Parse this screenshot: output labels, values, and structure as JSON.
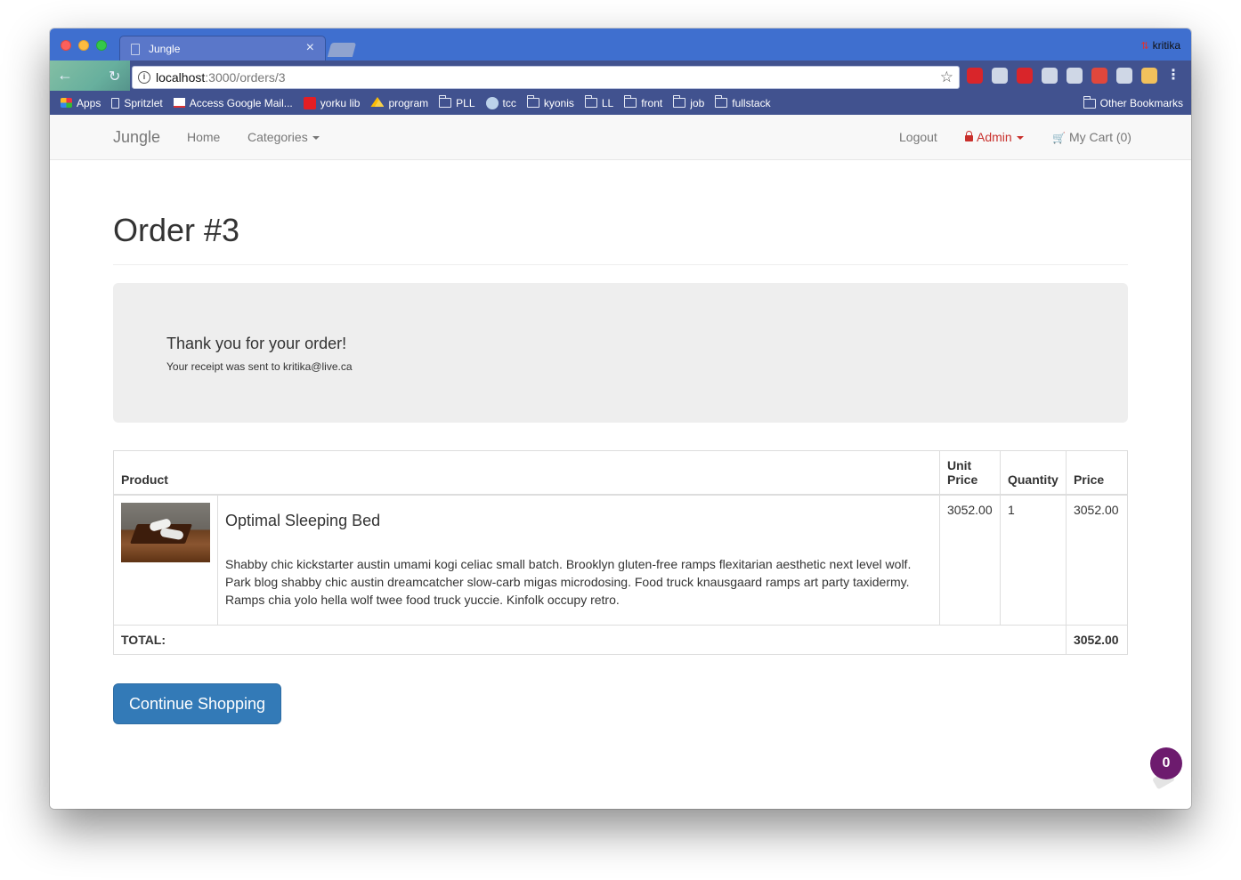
{
  "browser": {
    "tab_title": "Jungle",
    "tab_close": "×",
    "profile_name": "kritika",
    "url_host": "localhost",
    "url_rest": ":3000/orders/3",
    "bookmarks": [
      {
        "label": "Apps",
        "icon": "apps-grid-icon"
      },
      {
        "label": "Spritzlet",
        "icon": "page-icon"
      },
      {
        "label": "Access Google Mail...",
        "icon": "gmail-icon"
      },
      {
        "label": "yorku lib",
        "icon": "yorku-icon"
      },
      {
        "label": "program",
        "icon": "drive-icon"
      },
      {
        "label": "PLL",
        "icon": "folder-icon"
      },
      {
        "label": "tcc",
        "icon": "hn-icon"
      },
      {
        "label": "kyonis",
        "icon": "folder-icon"
      },
      {
        "label": "LL",
        "icon": "folder-icon"
      },
      {
        "label": "front",
        "icon": "folder-icon"
      },
      {
        "label": "job",
        "icon": "folder-icon"
      },
      {
        "label": "fullstack",
        "icon": "folder-icon"
      }
    ],
    "other_bookmarks": "Other Bookmarks",
    "extension_colors": [
      "#d9252a",
      "#cfd7e6",
      "#d9252a",
      "#cfd7e6",
      "#cfd7e6",
      "#e0473c",
      "#cfd7e6",
      "#f2c15c"
    ]
  },
  "navbar": {
    "brand": "Jungle",
    "home": "Home",
    "categories": "Categories",
    "logout": "Logout",
    "admin": "Admin",
    "cart": "My Cart (0)"
  },
  "order": {
    "title": "Order #3",
    "thanks_heading": "Thank you for your order!",
    "receipt_text": "Your receipt was sent to kritika@live.ca",
    "headers": {
      "product": "Product",
      "unit_price": "Unit Price",
      "quantity": "Quantity",
      "price": "Price"
    },
    "items": [
      {
        "name": "Optimal Sleeping Bed",
        "description": "Shabby chic kickstarter austin umami kogi celiac small batch. Brooklyn gluten-free ramps flexitarian aesthetic next level wolf. Park blog shabby chic austin dreamcatcher slow-carb migas microdosing. Food truck knausgaard ramps art party taxidermy. Ramps chia yolo hella wolf twee food truck yuccie. Kinfolk occupy retro.",
        "unit_price": "3052.00",
        "quantity": "1",
        "price": "3052.00"
      }
    ],
    "total_label": "TOTAL:",
    "total_value": "3052.00",
    "continue_button": "Continue Shopping"
  },
  "widget": {
    "badge_count": "0"
  }
}
